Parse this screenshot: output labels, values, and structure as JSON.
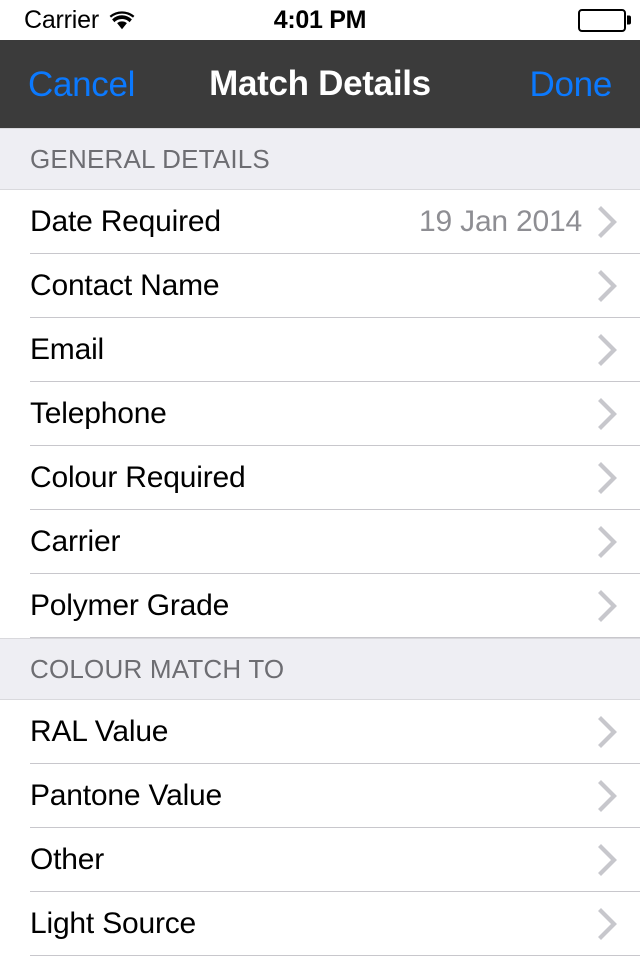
{
  "status_bar": {
    "carrier": "Carrier",
    "wifi_icon": "wifi-icon",
    "time": "4:01 PM",
    "battery_icon": "battery-full-icon"
  },
  "nav_bar": {
    "cancel_label": "Cancel",
    "title": "Match Details",
    "done_label": "Done",
    "background_color": "#3b3b3b",
    "tint_color": "#0b79fe"
  },
  "theme": {
    "section_header_bg": "#eeeef3",
    "section_header_text": "#6d6d72",
    "row_bg": "#ffffff",
    "row_text": "#000000",
    "row_value_text": "#8e8e93",
    "separator": "#c8c7cc",
    "chevron": "#c7c7cc"
  },
  "sections": [
    {
      "header": "GENERAL DETAILS",
      "rows": [
        {
          "label": "Date Required",
          "value": "19 Jan 2014",
          "accessory": "chevron-right-icon"
        },
        {
          "label": "Contact Name",
          "value": "",
          "accessory": "chevron-right-icon"
        },
        {
          "label": "Email",
          "value": "",
          "accessory": "chevron-right-icon"
        },
        {
          "label": "Telephone",
          "value": "",
          "accessory": "chevron-right-icon"
        },
        {
          "label": "Colour Required",
          "value": "",
          "accessory": "chevron-right-icon"
        },
        {
          "label": "Carrier",
          "value": "",
          "accessory": "chevron-right-icon"
        },
        {
          "label": "Polymer Grade",
          "value": "",
          "accessory": "chevron-right-icon"
        }
      ]
    },
    {
      "header": "COLOUR MATCH TO",
      "rows": [
        {
          "label": "RAL Value",
          "value": "",
          "accessory": "chevron-right-icon"
        },
        {
          "label": "Pantone Value",
          "value": "",
          "accessory": "chevron-right-icon"
        },
        {
          "label": "Other",
          "value": "",
          "accessory": "chevron-right-icon"
        },
        {
          "label": "Light Source",
          "value": "",
          "accessory": "chevron-right-icon"
        }
      ]
    }
  ]
}
